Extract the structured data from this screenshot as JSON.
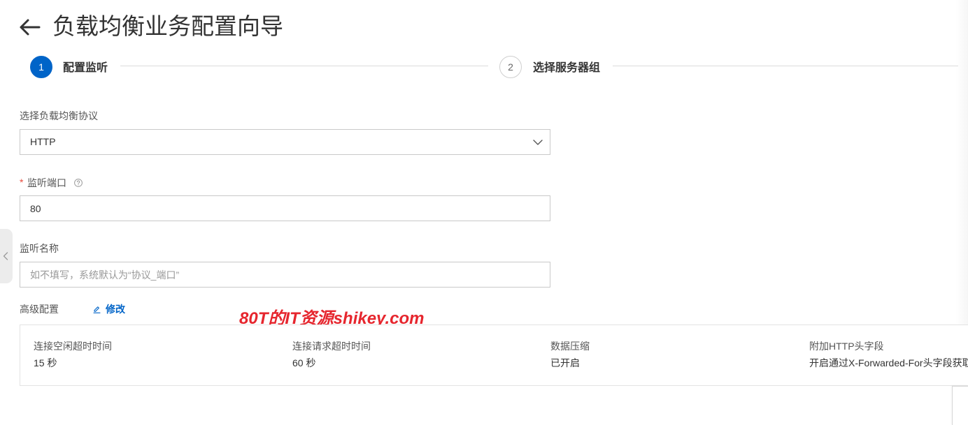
{
  "header": {
    "title": "负载均衡业务配置向导"
  },
  "steps": [
    {
      "number": "1",
      "label": "配置监听",
      "active": true
    },
    {
      "number": "2",
      "label": "选择服务器组",
      "active": false
    }
  ],
  "form": {
    "protocol": {
      "label": "选择负载均衡协议",
      "value": "HTTP"
    },
    "port": {
      "required_mark": "*",
      "label": "监听端口",
      "value": "80"
    },
    "listener_name": {
      "label": "监听名称",
      "placeholder": "如不填写，系统默认为“协议_端口”"
    }
  },
  "advanced": {
    "label": "高级配置",
    "edit_label": "修改",
    "items": [
      {
        "label": "连接空闲超时时间",
        "value": "15 秒"
      },
      {
        "label": "连接请求超时时间",
        "value": "60 秒"
      },
      {
        "label": "数据压缩",
        "value": "已开启"
      },
      {
        "label": "附加HTTP头字段",
        "value": "开启通过X-Forwarded-For头字段获取"
      }
    ]
  },
  "watermark": "80T的IT资源shikey.com",
  "icons": {
    "back": "arrow-left-icon",
    "protocol_dropdown": "chevron-down-icon",
    "port_help": "question-circle-icon",
    "advanced_edit": "edit-pencil-icon",
    "sidebar_collapse": "chevron-left-icon"
  },
  "colors": {
    "primary": "#0064c8",
    "required": "#e84c3d",
    "watermark": "#e6262e",
    "text": "#333333",
    "border": "#c9c9c9"
  }
}
